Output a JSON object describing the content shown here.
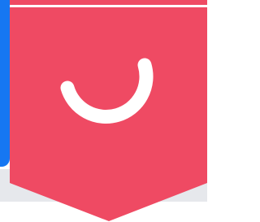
{
  "app": {
    "logo_icon": "pocket-logo-icon",
    "colors": {
      "brand": "#ef4a63",
      "accent": "#1677f2",
      "background": "#ffffff",
      "strip": "#e6e8ec"
    }
  }
}
